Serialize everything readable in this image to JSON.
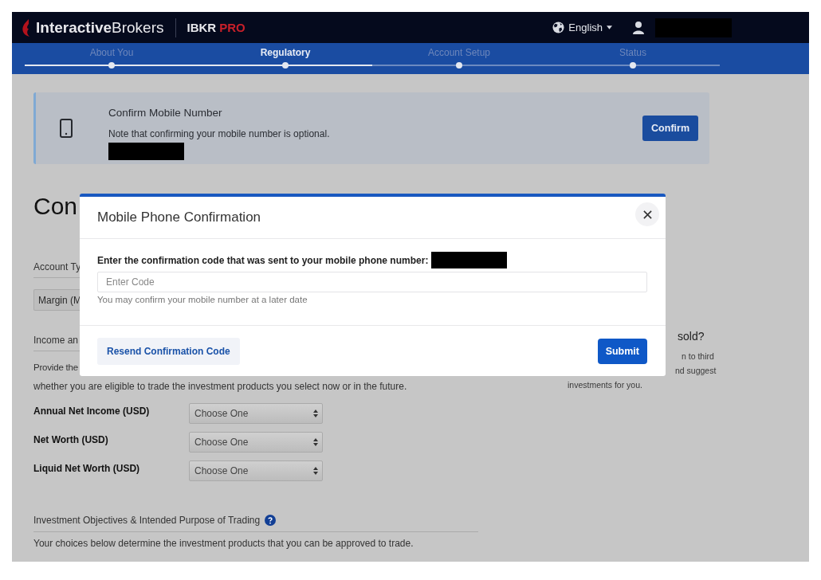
{
  "header": {
    "logo": "**Interactive**Brokers",
    "product": "IBKR",
    "tier": "PRO",
    "language": "English"
  },
  "steps": {
    "progress": {
      "level": 0.5
    },
    "items": [
      {
        "label": "About You",
        "selected": false
      },
      {
        "label": "Regulatory",
        "selected": true
      },
      {
        "label": "Account Setup",
        "selected": false
      },
      {
        "label": "Status",
        "selected": false
      }
    ]
  },
  "banner": {
    "title": "Confirm Mobile Number",
    "note": "Note that confirming your mobile number is optional.",
    "button": "Confirm"
  },
  "page": {
    "heading": "Con",
    "account_type": {
      "label": "Account Ty",
      "value": "Margin (M"
    },
    "income": {
      "heading": "Income an",
      "text_line_1": "Provide the",
      "text_line_2": "whether you are eligible to trade the investment products you select now or in the future.",
      "fields": [
        {
          "label": "Annual Net Income (USD)",
          "value": "Choose One"
        },
        {
          "label": "Net Worth (USD)",
          "value": "Choose One"
        },
        {
          "label": "Liquid Net Worth (USD)",
          "value": "Choose One"
        }
      ]
    },
    "objectives": {
      "heading": "Investment Objectives & Intended Purpose of Trading",
      "text": "Your choices below determine the investment products that you can be approved to trade."
    }
  },
  "side": {
    "heading": "sold?",
    "lines": [
      "n to third",
      "nd suggest",
      "investments for you."
    ]
  },
  "modal": {
    "title": "Mobile Phone Confirmation",
    "prompt": "Enter the confirmation code that was sent to your mobile phone number:",
    "placeholder": "Enter Code",
    "hint": "You may confirm your mobile number at a later date",
    "resend": "Resend Confirmation Code",
    "submit": "Submit"
  }
}
